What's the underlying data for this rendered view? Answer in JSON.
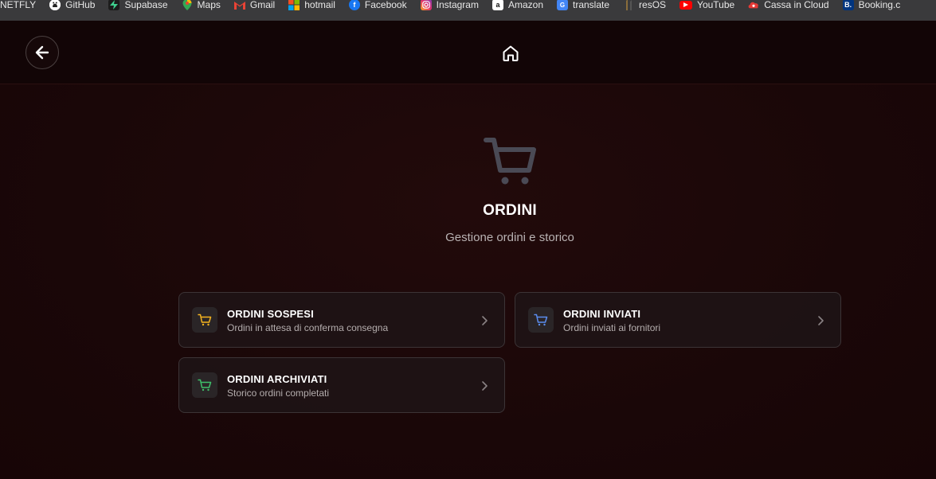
{
  "bookmarks": [
    {
      "label": "NETFLY",
      "icon": "none",
      "color": ""
    },
    {
      "label": "GitHub",
      "icon": "github-icon",
      "color": "#ffffff"
    },
    {
      "label": "Supabase",
      "icon": "supabase-icon",
      "color": "#3ecf8e"
    },
    {
      "label": "Maps",
      "icon": "maps-icon",
      "color": "#34a853"
    },
    {
      "label": "Gmail",
      "icon": "gmail-icon",
      "color": "#ea4335"
    },
    {
      "label": "hotmail",
      "icon": "microsoft-icon",
      "color": "#f25022"
    },
    {
      "label": "Facebook",
      "icon": "facebook-icon",
      "color": "#1877f2"
    },
    {
      "label": "Instagram",
      "icon": "instagram-icon",
      "color": "#e1306c"
    },
    {
      "label": "Amazon",
      "icon": "amazon-icon",
      "color": "#ffffff"
    },
    {
      "label": "translate",
      "icon": "translate-icon",
      "color": "#4285f4"
    },
    {
      "label": "resOS",
      "icon": "resos-icon",
      "color": "#8a6d3b"
    },
    {
      "label": "YouTube",
      "icon": "youtube-icon",
      "color": "#ff0000"
    },
    {
      "label": "Cassa in Cloud",
      "icon": "cassa-icon",
      "color": "#e53935"
    },
    {
      "label": "Booking.c",
      "icon": "booking-icon",
      "color": "#003580"
    }
  ],
  "header": {
    "back_icon": "arrow-left-icon",
    "home_icon": "home-icon"
  },
  "hero": {
    "icon": "shopping-cart-icon",
    "title": "ORDINI",
    "subtitle": "Gestione ordini e storico"
  },
  "cards": [
    {
      "title": "ORDINI SOSPESI",
      "subtitle": "Ordini in attesa di conferma consegna",
      "icon_color": "#f5b41f"
    },
    {
      "title": "ORDINI INVIATI",
      "subtitle": "Ordini inviati ai fornitori",
      "icon_color": "#5b8def"
    },
    {
      "title": "ORDINI ARCHIVIATI",
      "subtitle": "Storico ordini completati",
      "icon_color": "#3fbf6a"
    }
  ],
  "colors": {
    "background": "#1a0707",
    "card_border": "#3c3436",
    "hero_icon": "#4a4a55"
  }
}
